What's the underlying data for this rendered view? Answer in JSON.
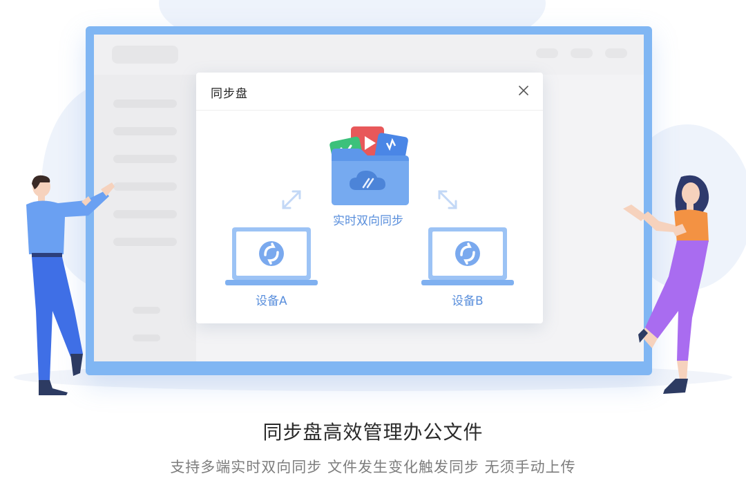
{
  "dialog": {
    "title": "同步盘",
    "folder_label": "实时双向同步",
    "device_a": "设备A",
    "device_b": "设备B"
  },
  "icons": {
    "close": "close-icon",
    "folder": "cloud-folder-icon",
    "sync": "sync-icon",
    "arrow": "double-arrow-icon"
  },
  "caption": {
    "title": "同步盘高效管理办公文件",
    "subtitle": "支持多端实时双向同步 文件发生变化触发同步 无须手动上传"
  },
  "colors": {
    "accent": "#5a8fdc",
    "frame": "#80b6f3",
    "folder": "#5d97ea",
    "doc_green": "#3cc17b",
    "doc_red": "#e8585a"
  }
}
